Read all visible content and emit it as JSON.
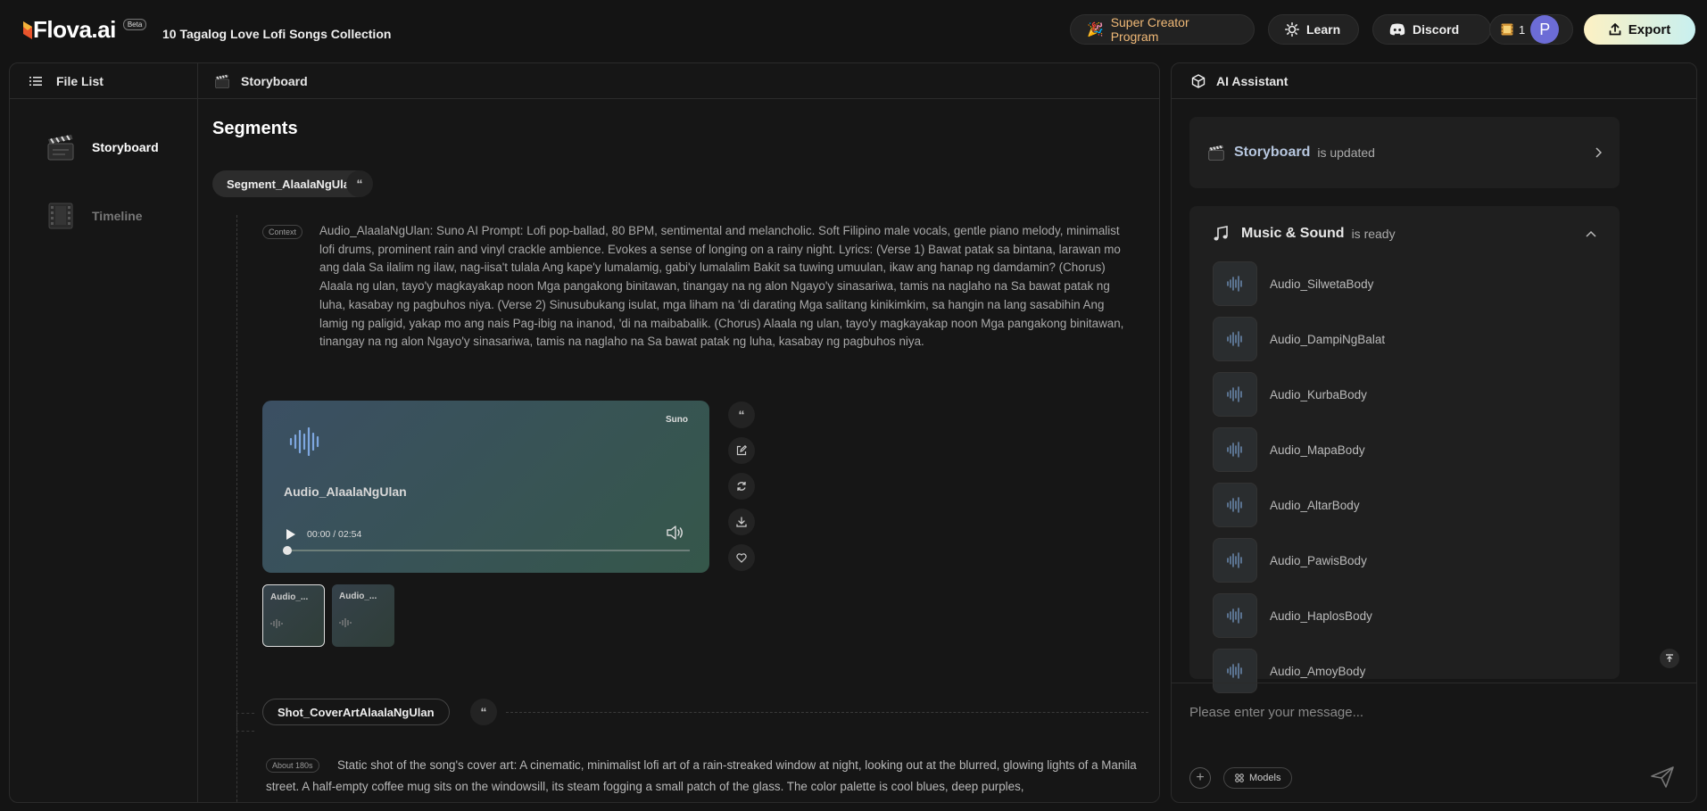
{
  "app": {
    "logo_text": "Flova.ai",
    "beta_label": "Beta",
    "project_title": "10 Tagalog Love Lofi Songs Collection"
  },
  "topbar": {
    "creator_label": "Super Creator Program",
    "learn_label": "Learn",
    "discord_label": "Discord",
    "credits_count": "1",
    "avatar_letter": "P",
    "export_label": "Export"
  },
  "sidebar": {
    "header": "File List",
    "items": [
      {
        "label": "Storyboard",
        "active": true
      },
      {
        "label": "Timeline",
        "active": false
      }
    ]
  },
  "content": {
    "header": "Storyboard",
    "title": "Segments",
    "segment_name": "Segment_AlaalaNgUlan",
    "context_tag": "Context",
    "context_text": "Audio_AlaalaNgUlan: Suno AI Prompt: Lofi pop-ballad, 80 BPM, sentimental and melancholic. Soft Filipino male vocals, gentle piano melody, minimalist lofi drums, prominent rain and vinyl crackle ambience. Evokes a sense of longing on a rainy night. Lyrics: (Verse 1) Bawat patak sa bintana, larawan mo ang dala Sa ilalim ng ilaw, nag-iisa't tulala Ang kape'y lumalamig, gabi'y lumalalim Bakit sa tuwing umuulan, ikaw ang hanap ng damdamin? (Chorus) Alaala ng ulan, tayo'y magkayakap noon Mga pangakong binitawan, tinangay na ng alon Ngayo'y sinasariwa, tamis na naglaho na Sa bawat patak ng luha, kasabay ng pagbuhos niya. (Verse 2) Sinusubukang isulat, mga liham na 'di darating Mga salitang kinikimkim, sa hangin na lang sasabihin Ang lamig ng paligid, yakap mo ang nais Pag-ibig na inanod, 'di na maibabalik. (Chorus) Alaala ng ulan, tayo'y magkayakap noon Mga pangakong binitawan, tinangay na ng alon Ngayo'y sinasariwa, tamis na naglaho na Sa bawat patak ng luha, kasabay ng pagbuhos niya.",
    "audio_card": {
      "provider": "Suno",
      "name": "Audio_AlaalaNgUlan",
      "time": "00:00 / 02:54",
      "progress": 0
    },
    "thumbs": [
      {
        "label": "Audio_..."
      },
      {
        "label": "Audio_..."
      }
    ],
    "shot_name": "Shot_CoverArtAlaalaNgUlan",
    "shot_tag": "About 180s",
    "shot_text": "Static shot of the song's cover art: A cinematic, minimalist lofi art of a rain-streaked window at night, looking out at the blurred, glowing lights of a Manila street. A half-empty coffee mug sits on the windowsill, its steam fogging a small patch of the glass. The color palette is cool blues, deep purples,"
  },
  "assistant": {
    "header": "AI Assistant",
    "storyboard_status": {
      "title": "Storyboard",
      "status": "is updated"
    },
    "music_status": {
      "title": "Music & Sound",
      "status": "is ready"
    },
    "audio_items": [
      "Audio_SilwetaBody",
      "Audio_DampiNgBalat",
      "Audio_KurbaBody",
      "Audio_MapaBody",
      "Audio_AltarBody",
      "Audio_PawisBody",
      "Audio_HaplosBody",
      "Audio_AmoyBody"
    ],
    "input_placeholder": "Please enter your message...",
    "models_label": "Models"
  },
  "colors": {
    "background": "#141414",
    "creator_accent": "#f0b977",
    "avatar": "#6c6cd6",
    "storyboard_accent": "#b6c6de"
  }
}
